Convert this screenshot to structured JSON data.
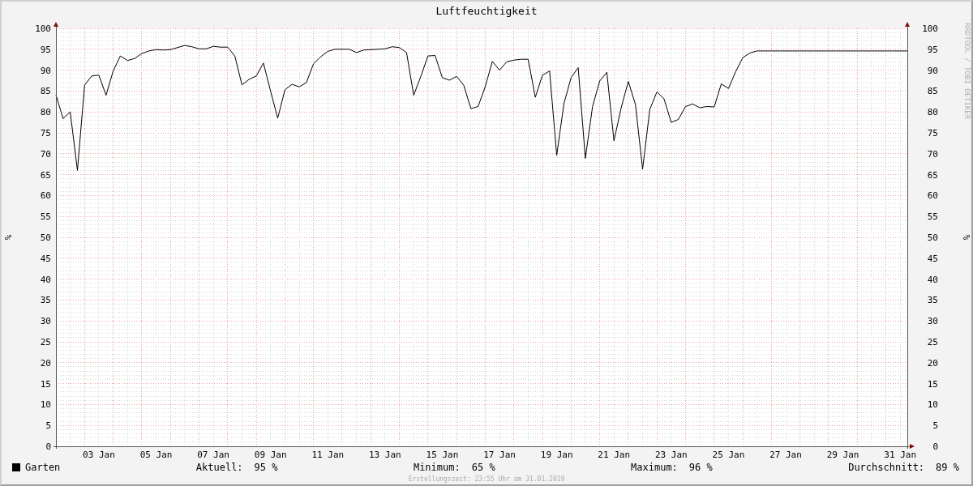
{
  "chart_data": {
    "type": "line",
    "title": "Luftfeuchtigkeit",
    "ylabel": "%",
    "ylim": [
      0,
      100
    ],
    "grid": true,
    "categories": [
      null,
      null,
      null,
      null,
      null,
      null,
      "03 Jan",
      null,
      null,
      null,
      null,
      null,
      null,
      null,
      "05 Jan",
      null,
      null,
      null,
      null,
      null,
      null,
      null,
      "07 Jan",
      null,
      null,
      null,
      null,
      null,
      null,
      null,
      "09 Jan",
      null,
      null,
      null,
      null,
      null,
      null,
      null,
      "11 Jan",
      null,
      null,
      null,
      null,
      null,
      null,
      null,
      "13 Jan",
      null,
      null,
      null,
      null,
      null,
      null,
      null,
      "15 Jan",
      null,
      null,
      null,
      null,
      null,
      null,
      null,
      "17 Jan",
      null,
      null,
      null,
      null,
      null,
      null,
      null,
      "19 Jan",
      null,
      null,
      null,
      null,
      null,
      null,
      null,
      "21 Jan",
      null,
      null,
      null,
      null,
      null,
      null,
      null,
      "23 Jan",
      null,
      null,
      null,
      null,
      null,
      null,
      null,
      "25 Jan",
      null,
      null,
      null,
      null,
      null,
      null,
      null,
      "27 Jan",
      null,
      null,
      null,
      null,
      null,
      null,
      null,
      "29 Jan",
      null,
      null,
      null,
      null,
      null,
      null,
      null,
      "31 Jan",
      null
    ],
    "yticks": [
      0,
      5,
      10,
      15,
      20,
      25,
      30,
      35,
      40,
      45,
      50,
      55,
      60,
      65,
      70,
      75,
      80,
      85,
      90,
      95,
      100
    ],
    "series": [
      {
        "name": "Garten",
        "color": "#000000",
        "values": [
          84.1,
          78.4,
          80,
          66,
          86.4,
          88.6,
          88.8,
          84,
          89.8,
          93.4,
          92.3,
          92.8,
          94,
          94.6,
          94.9,
          94.8,
          94.9,
          95.4,
          95.9,
          95.6,
          95.1,
          95.1,
          95.7,
          95.5,
          95.5,
          93.4,
          86.5,
          87.8,
          88.6,
          91.7,
          85,
          78.5,
          85.3,
          86.6,
          86,
          87,
          91.5,
          93.2,
          94.5,
          95,
          95,
          95,
          94.2,
          94.8,
          94.9,
          95,
          95.1,
          95.6,
          95.4,
          94.2,
          84,
          88.5,
          93.4,
          93.5,
          88.2,
          87.6,
          88.5,
          86.4,
          80.8,
          81.3,
          86,
          92.1,
          90,
          92,
          92.4,
          92.6,
          92.6,
          83.5,
          88.8,
          89.8,
          69.6,
          82,
          88.2,
          90.6,
          68.9,
          81.3,
          87.4,
          89.5,
          73.1,
          81,
          87.3,
          81.8,
          66.3,
          80.6,
          84.8,
          83.1,
          77.5,
          78.2,
          81.3,
          81.9,
          81,
          81.3,
          81.2,
          86.7,
          85.6,
          89.6,
          93,
          94.1,
          94.6,
          94.6,
          94.6,
          94.6,
          94.6,
          94.6,
          94.6,
          94.6,
          94.6,
          94.6,
          94.6,
          94.6,
          94.6,
          94.6,
          94.6,
          94.6,
          94.6,
          94.6,
          94.6,
          94.6,
          94.6,
          94.6
        ]
      }
    ]
  },
  "right_axis": {
    "label": "%",
    "ticks": [
      "100",
      "95",
      "90",
      "85",
      "80",
      "75",
      "70",
      "65",
      "60",
      "55",
      "50",
      "45",
      "40",
      "35",
      "30",
      "25",
      "20",
      "15",
      "10",
      "5",
      "0"
    ]
  },
  "credit": "RRDTOOL / TOBI OETIKER",
  "legend": {
    "stats": [
      {
        "label": "Aktuell:",
        "value": "95 %"
      },
      {
        "label": "Minimum:",
        "value": "65 %"
      },
      {
        "label": "Maximum:",
        "value": "96 %"
      },
      {
        "label": "Durchschnitt:",
        "value": "89 %"
      }
    ]
  },
  "footer": "Erstellungszeit: 23:55 Uhr am 31.01.2019"
}
